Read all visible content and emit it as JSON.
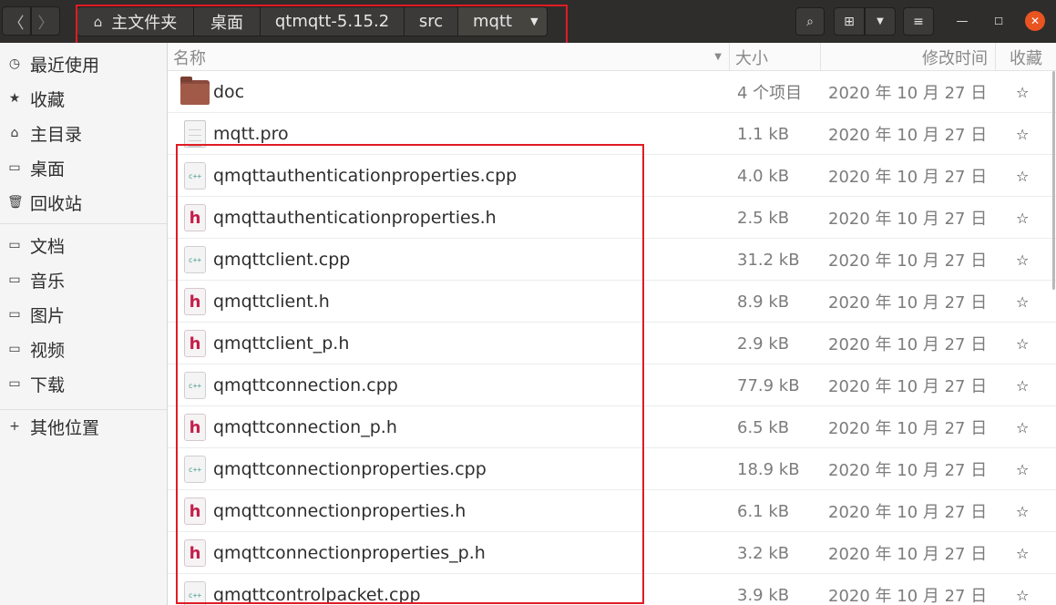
{
  "nav": {
    "back": "〈",
    "forward": "〉"
  },
  "pathbar": {
    "home_icon": "⌂",
    "crumbs": [
      "主文件夹",
      "桌面",
      "qtmqtt-5.15.2",
      "src",
      "mqtt"
    ],
    "dropdown_icon": "▼"
  },
  "toolbar": {
    "search_icon": "⌕",
    "grid_icon": "⊞",
    "grid_menu_icon": "▼",
    "menu_icon": "≡"
  },
  "window": {
    "minimize": "—",
    "maximize": "☐",
    "close": "✕"
  },
  "sidebar": {
    "items": [
      {
        "icon": "◷",
        "label": "最近使用"
      },
      {
        "icon": "★",
        "label": "收藏"
      },
      {
        "icon": "⌂",
        "label": "主目录"
      },
      {
        "icon": "▭",
        "label": "桌面"
      },
      {
        "icon": "🗑",
        "label": "回收站"
      },
      {
        "icon": "▭",
        "label": "文档"
      },
      {
        "icon": "▭",
        "label": "音乐"
      },
      {
        "icon": "▭",
        "label": "图片"
      },
      {
        "icon": "▭",
        "label": "视频"
      },
      {
        "icon": "▭",
        "label": "下载"
      },
      {
        "icon": "+",
        "label": "其他位置"
      }
    ]
  },
  "columns": {
    "name": "名称",
    "size": "大小",
    "modified": "修改时间",
    "starred": "收藏",
    "sort_icon": "▼"
  },
  "files": [
    {
      "type": "folder",
      "name": "doc",
      "size": "4 个项目",
      "modified": "2020 年 10 月 27 日",
      "star": "☆"
    },
    {
      "type": "doc",
      "name": "mqtt.pro",
      "size": "1.1 kB",
      "modified": "2020 年 10 月 27 日",
      "star": "☆"
    },
    {
      "type": "cpp",
      "name": "qmqttauthenticationproperties.cpp",
      "size": "4.0 kB",
      "modified": "2020 年 10 月 27 日",
      "star": "☆"
    },
    {
      "type": "h",
      "name": "qmqttauthenticationproperties.h",
      "size": "2.5 kB",
      "modified": "2020 年 10 月 27 日",
      "star": "☆"
    },
    {
      "type": "cpp",
      "name": "qmqttclient.cpp",
      "size": "31.2 kB",
      "modified": "2020 年 10 月 27 日",
      "star": "☆"
    },
    {
      "type": "h",
      "name": "qmqttclient.h",
      "size": "8.9 kB",
      "modified": "2020 年 10 月 27 日",
      "star": "☆"
    },
    {
      "type": "h",
      "name": "qmqttclient_p.h",
      "size": "2.9 kB",
      "modified": "2020 年 10 月 27 日",
      "star": "☆"
    },
    {
      "type": "cpp",
      "name": "qmqttconnection.cpp",
      "size": "77.9 kB",
      "modified": "2020 年 10 月 27 日",
      "star": "☆"
    },
    {
      "type": "h",
      "name": "qmqttconnection_p.h",
      "size": "6.5 kB",
      "modified": "2020 年 10 月 27 日",
      "star": "☆"
    },
    {
      "type": "cpp",
      "name": "qmqttconnectionproperties.cpp",
      "size": "18.9 kB",
      "modified": "2020 年 10 月 27 日",
      "star": "☆"
    },
    {
      "type": "h",
      "name": "qmqttconnectionproperties.h",
      "size": "6.1 kB",
      "modified": "2020 年 10 月 27 日",
      "star": "☆"
    },
    {
      "type": "h",
      "name": "qmqttconnectionproperties_p.h",
      "size": "3.2 kB",
      "modified": "2020 年 10 月 27 日",
      "star": "☆"
    },
    {
      "type": "cpp",
      "name": "qmqttcontrolpacket.cpp",
      "size": "3.9 kB",
      "modified": "2020 年 10 月 27 日",
      "star": "☆"
    }
  ],
  "file_icons": {
    "cpp": "c++",
    "h": "h"
  },
  "colors": {
    "highlight_box": "#e01b24",
    "header_bg": "#2e2d2c",
    "close_button": "#e95420"
  }
}
